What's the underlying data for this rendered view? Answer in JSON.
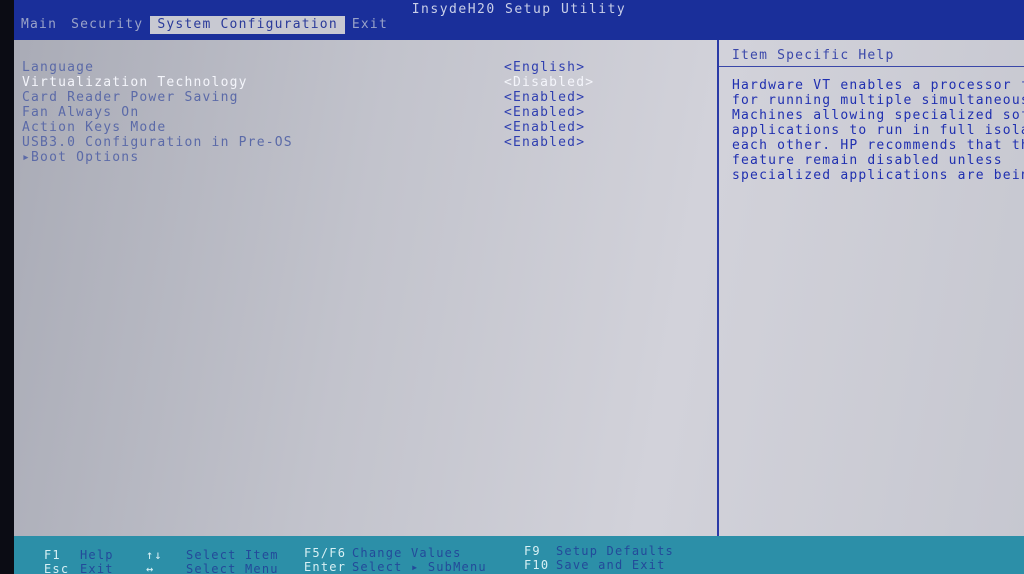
{
  "app": {
    "title": "InsydeH20 Setup Utility"
  },
  "menu": {
    "tabs": [
      {
        "label": "Main"
      },
      {
        "label": "Security"
      },
      {
        "label": "System Configuration"
      },
      {
        "label": "Exit"
      }
    ],
    "active_index": 2
  },
  "settings": {
    "items": [
      {
        "label": "Language",
        "value": "<English>"
      },
      {
        "label": "Virtualization Technology",
        "value": "<Disabled>"
      },
      {
        "label": "Card Reader Power Saving",
        "value": "<Enabled>"
      },
      {
        "label": "Fan Always On",
        "value": "<Enabled>"
      },
      {
        "label": "Action Keys Mode",
        "value": "<Enabled>"
      },
      {
        "label": "USB3.0 Configuration in Pre-OS",
        "value": "<Enabled>"
      },
      {
        "label": "▸Boot Options",
        "value": ""
      }
    ],
    "selected_index": 1
  },
  "help": {
    "header": "Item Specific Help",
    "lines": [
      "Hardware VT enables a processor fe",
      "for running multiple simultaneous V",
      "Machines allowing specialized softw",
      "applications to run in full isolati",
      "each other. HP recommends that this",
      "feature remain disabled unless",
      "specialized applications are being u"
    ]
  },
  "footer": {
    "f1_key": "F1",
    "f1_desc": "Help",
    "esc_key": "Esc",
    "esc_desc": "Exit",
    "updown_key": "↑↓",
    "updown_desc": "Select Item",
    "leftright_key": "↔",
    "leftright_desc": "Select Menu",
    "f5f6_key": "F5/F6",
    "f5f6_desc": "Change Values",
    "enter_key": "Enter",
    "enter_desc": "Select ▸ SubMenu",
    "f9_key": "F9",
    "f9_desc": "Setup Defaults",
    "f10_key": "F10",
    "f10_desc": "Save and Exit"
  }
}
